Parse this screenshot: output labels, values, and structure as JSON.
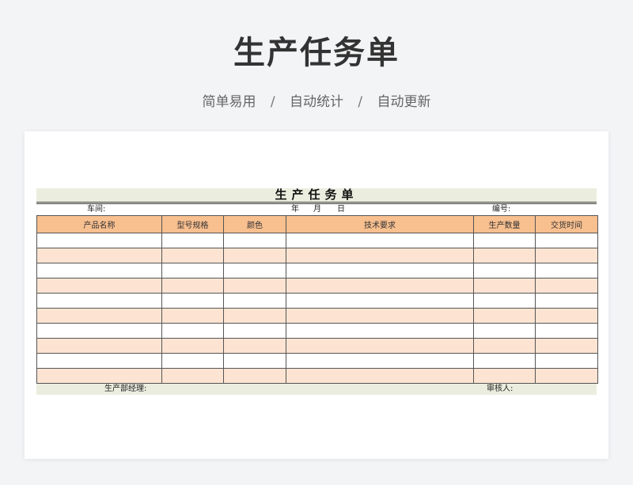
{
  "header": {
    "title": "生产任务单",
    "features": [
      "简单易用",
      "自动统计",
      "自动更新"
    ],
    "separator": "/"
  },
  "form": {
    "title": "生产任务单",
    "workshop_label": "车间:",
    "year_label": "年",
    "month_label": "月",
    "day_label": "日",
    "serial_label": "编号:",
    "columns": [
      "产品名称",
      "型号规格",
      "颜色",
      "技术要求",
      "生产数量",
      "交货时间"
    ],
    "rows": [
      [
        "",
        "",
        "",
        "",
        "",
        ""
      ],
      [
        "",
        "",
        "",
        "",
        "",
        ""
      ],
      [
        "",
        "",
        "",
        "",
        "",
        ""
      ],
      [
        "",
        "",
        "",
        "",
        "",
        ""
      ],
      [
        "",
        "",
        "",
        "",
        "",
        ""
      ],
      [
        "",
        "",
        "",
        "",
        "",
        ""
      ],
      [
        "",
        "",
        "",
        "",
        "",
        ""
      ],
      [
        "",
        "",
        "",
        "",
        "",
        ""
      ],
      [
        "",
        "",
        "",
        "",
        "",
        ""
      ],
      [
        "",
        "",
        "",
        "",
        "",
        ""
      ]
    ],
    "manager_label": "生产部经理:",
    "reviewer_label": "审核人:"
  },
  "colors": {
    "header_fill": "#f8bf8f",
    "band_fill": "#fde4d2",
    "title_band": "#ebeedf"
  }
}
